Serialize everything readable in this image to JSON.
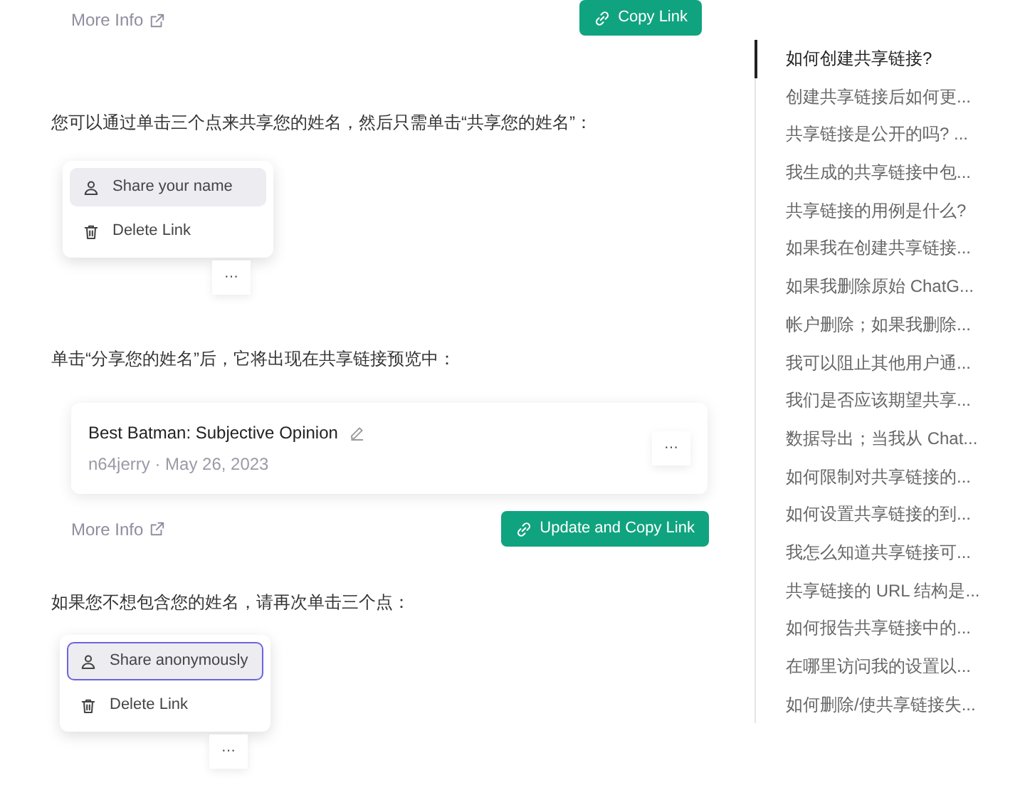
{
  "top_actions": {
    "more_info": "More Info",
    "button": "Copy Link"
  },
  "sections": [
    {
      "text": "您可以通过单击三个点来共享您的姓名，然后只需单击“共享您的姓名”：",
      "kind": "menu",
      "menu": [
        {
          "kind": "person",
          "label": "Share your name",
          "highlighted": true,
          "focus_ring": false
        },
        {
          "kind": "trash",
          "label": "Delete Link",
          "highlighted": false,
          "focus_ring": false
        }
      ],
      "dots": "···"
    },
    {
      "text": "单击“分享您的姓名”后，它将出现在共享链接预览中：",
      "kind": "preview",
      "preview": {
        "title": "Best Batman: Subjective Opinion",
        "meta": "n64jerry · May 26, 2023",
        "dots": "···"
      },
      "more_info": "More Info",
      "button": "Update and Copy Link"
    },
    {
      "text": "如果您不想包含您的姓名，请再次单击三个点：",
      "kind": "menu",
      "menu": [
        {
          "kind": "person",
          "label": "Share anonymously",
          "highlighted": true,
          "focus_ring": true
        },
        {
          "kind": "trash",
          "label": "Delete Link",
          "highlighted": false,
          "focus_ring": false
        }
      ],
      "dots": "···"
    }
  ],
  "toc": [
    {
      "label": "如何创建共享链接?",
      "selected": true
    },
    {
      "label": "创建共享链接后如何更...",
      "selected": false
    },
    {
      "label": "共享链接是公开的吗? ...",
      "selected": false
    },
    {
      "label": "我生成的共享链接中包...",
      "selected": false
    },
    {
      "label": "共享链接的用例是什么?",
      "selected": false
    },
    {
      "label": "如果我在创建共享链接...",
      "selected": false
    },
    {
      "label": "如果我删除原始 ChatG...",
      "selected": false
    },
    {
      "label": "帐户删除；如果我删除...",
      "selected": false
    },
    {
      "label": "我可以阻止其他用户通...",
      "selected": false
    },
    {
      "label": "我们是否应该期望共享...",
      "selected": false
    },
    {
      "label": "数据导出；当我从 Chat...",
      "selected": false
    },
    {
      "label": "如何限制对共享链接的...",
      "selected": false
    },
    {
      "label": "如何设置共享链接的到...",
      "selected": false
    },
    {
      "label": "我怎么知道共享链接可...",
      "selected": false
    },
    {
      "label": "共享链接的 URL 结构是...",
      "selected": false
    },
    {
      "label": "如何报告共享链接中的...",
      "selected": false
    },
    {
      "label": "在哪里访问我的设置以...",
      "selected": false
    },
    {
      "label": "如何删除/使共享链接失...",
      "selected": false
    }
  ]
}
